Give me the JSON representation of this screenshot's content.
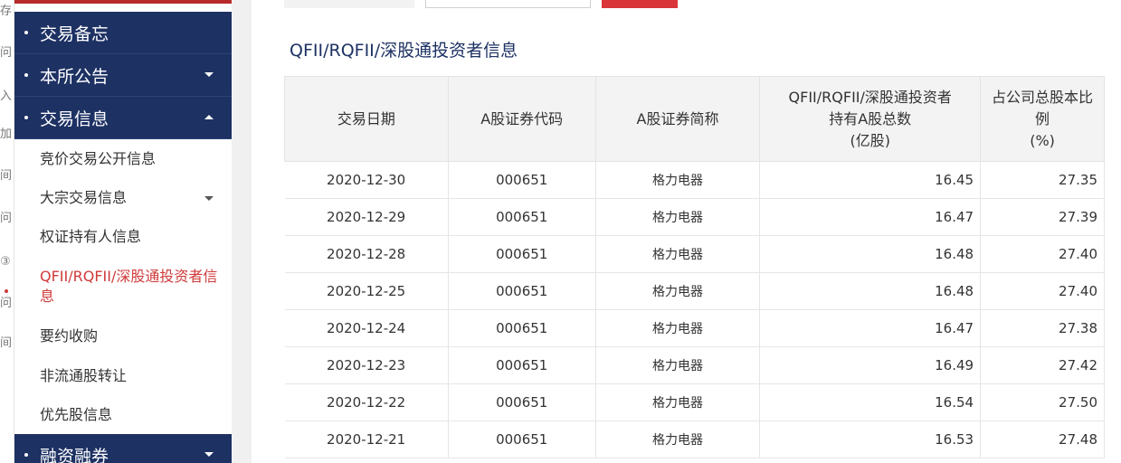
{
  "sidebar": {
    "headers": [
      {
        "label": "交易备忘"
      },
      {
        "label": "本所公告"
      },
      {
        "label": "交易信息"
      },
      {
        "label": "融资融券"
      }
    ],
    "sub_items": [
      {
        "label": "竞价交易公开信息"
      },
      {
        "label": "大宗交易信息"
      },
      {
        "label": "权证持有人信息"
      },
      {
        "label": "QFII/RQFII/深股通投资者信息"
      },
      {
        "label": "要约收购"
      },
      {
        "label": "非流通股转让"
      },
      {
        "label": "优先股信息"
      }
    ]
  },
  "edge_glyphs": [
    "存",
    "问",
    "入",
    "加",
    "间",
    "问",
    "③",
    "问",
    "间"
  ],
  "title": "QFII/RQFII/深股通投资者信息",
  "table": {
    "headers": [
      "交易日期",
      "A股证券代码",
      "A股证券简称",
      "QFII/RQFII/深股通投资者\n持有A股总数\n(亿股)",
      "占公司总股本比\n例\n(%)"
    ],
    "rows": [
      {
        "date": "2020-12-30",
        "code": "000651",
        "name": "格力电器",
        "shares": "16.45",
        "ratio": "27.35"
      },
      {
        "date": "2020-12-29",
        "code": "000651",
        "name": "格力电器",
        "shares": "16.47",
        "ratio": "27.39"
      },
      {
        "date": "2020-12-28",
        "code": "000651",
        "name": "格力电器",
        "shares": "16.48",
        "ratio": "27.40"
      },
      {
        "date": "2020-12-25",
        "code": "000651",
        "name": "格力电器",
        "shares": "16.48",
        "ratio": "27.40"
      },
      {
        "date": "2020-12-24",
        "code": "000651",
        "name": "格力电器",
        "shares": "16.47",
        "ratio": "27.38"
      },
      {
        "date": "2020-12-23",
        "code": "000651",
        "name": "格力电器",
        "shares": "16.49",
        "ratio": "27.42"
      },
      {
        "date": "2020-12-22",
        "code": "000651",
        "name": "格力电器",
        "shares": "16.54",
        "ratio": "27.50"
      },
      {
        "date": "2020-12-21",
        "code": "000651",
        "name": "格力电器",
        "shares": "16.53",
        "ratio": "27.48"
      }
    ]
  },
  "colors": {
    "nav_bg": "#1d3163",
    "accent_red": "#d03a3a",
    "button_red": "#d8343a"
  }
}
